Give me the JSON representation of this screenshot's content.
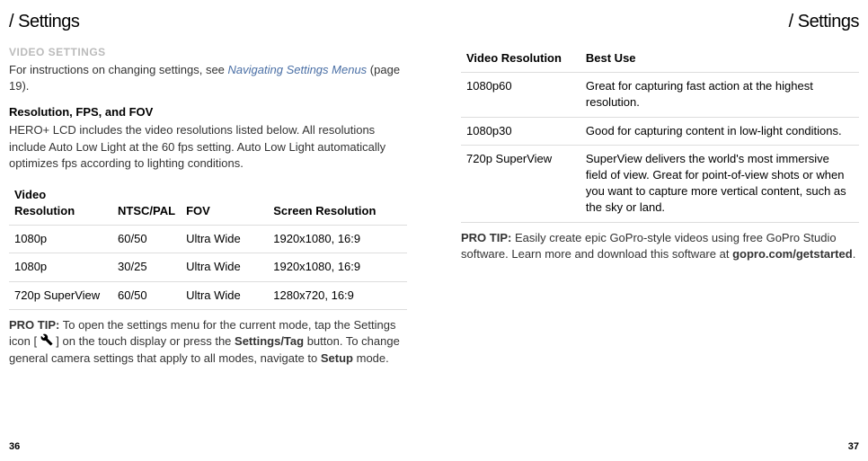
{
  "left": {
    "header": "/ Settings",
    "section_label": "VIDEO SETTINGS",
    "intro_pre": "For instructions on changing settings, see ",
    "intro_link": "Navigating Settings Menus",
    "intro_post": " (page 19).",
    "subhead": "Resolution, FPS, and FOV",
    "body": "HERO+ LCD includes the video resolutions listed below. All resolutions include Auto Low Light at the 60 fps setting. Auto Low Light automatically optimizes fps according to lighting conditions.",
    "table": {
      "headers": {
        "c0": "Video Resolution",
        "c1": "NTSC/PAL",
        "c2": "FOV",
        "c3": "Screen Resolution"
      },
      "rows": [
        {
          "c0": "1080p",
          "c1": "60/50",
          "c2": "Ultra Wide",
          "c3": "1920x1080, 16:9"
        },
        {
          "c0": "1080p",
          "c1": "30/25",
          "c2": "Ultra Wide",
          "c3": "1920x1080, 16:9"
        },
        {
          "c0": "720p SuperView",
          "c1": "60/50",
          "c2": "Ultra Wide",
          "c3": "1280x720, 16:9"
        }
      ]
    },
    "protip_label": "PRO TIP:",
    "protip_a": " To open the settings menu for the current mode, tap the Settings icon [ ",
    "protip_b": " ] on the touch display or press the ",
    "protip_bold1": "Settings/Tag",
    "protip_c": " button. To change general camera settings that apply to all modes, navigate to ",
    "protip_bold2": "Setup",
    "protip_d": " mode.",
    "pagenum": "36"
  },
  "right": {
    "header": "/ Settings",
    "table": {
      "headers": {
        "c0": "Video Resolution",
        "c1": "Best Use"
      },
      "rows": [
        {
          "c0": "1080p60",
          "c1": "Great for capturing fast action at the highest resolution."
        },
        {
          "c0": "1080p30",
          "c1": "Good for capturing content in low-light conditions."
        },
        {
          "c0": "720p SuperView",
          "c1": "SuperView delivers the world's most immersive field of view. Great for point-of-view shots or when you want to capture more vertical content, such as the sky or land."
        }
      ]
    },
    "protip_label": "PRO TIP:",
    "protip_a": " Easily create epic GoPro-style videos using free GoPro Studio software. Learn more and download this software at ",
    "protip_bold": "gopro.com/getstarted",
    "protip_b": ".",
    "pagenum": "37"
  }
}
